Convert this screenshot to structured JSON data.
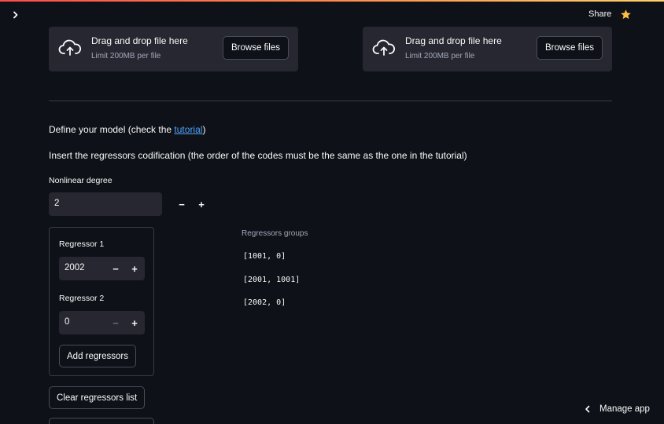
{
  "header": {
    "share_label": "Share",
    "star_color": "#ffbd45",
    "accent_gradient": [
      "#ff4b4b",
      "#ffd16a"
    ]
  },
  "uploaders": [
    {
      "title": "Drag and drop file here",
      "limit": "Limit 200MB per file",
      "button": "Browse files",
      "icon": "cloud-upload-icon"
    },
    {
      "title": "Drag and drop file here",
      "limit": "Limit 200MB per file",
      "button": "Browse files",
      "icon": "cloud-upload-icon"
    }
  ],
  "model": {
    "define_prefix": "Define your model (check the ",
    "tutorial_link": "tutorial",
    "define_suffix": ")",
    "instructions": "Insert the regressors codification (the order of the codes must be the same as the one in the tutorial)",
    "nonlinear_label": "Nonlinear degree",
    "nonlinear_value": "2"
  },
  "regressors": {
    "r1_label": "Regressor 1",
    "r1_value": "2002",
    "r2_label": "Regressor 2",
    "r2_value": "0",
    "add_button": "Add regressors",
    "clear_button": "Clear regressors list"
  },
  "groups": {
    "title": "Regressors groups",
    "items": [
      "[1001, 0]",
      "[2001, 1001]",
      "[2002, 0]"
    ]
  },
  "footer": {
    "manage_app": "Manage app"
  }
}
